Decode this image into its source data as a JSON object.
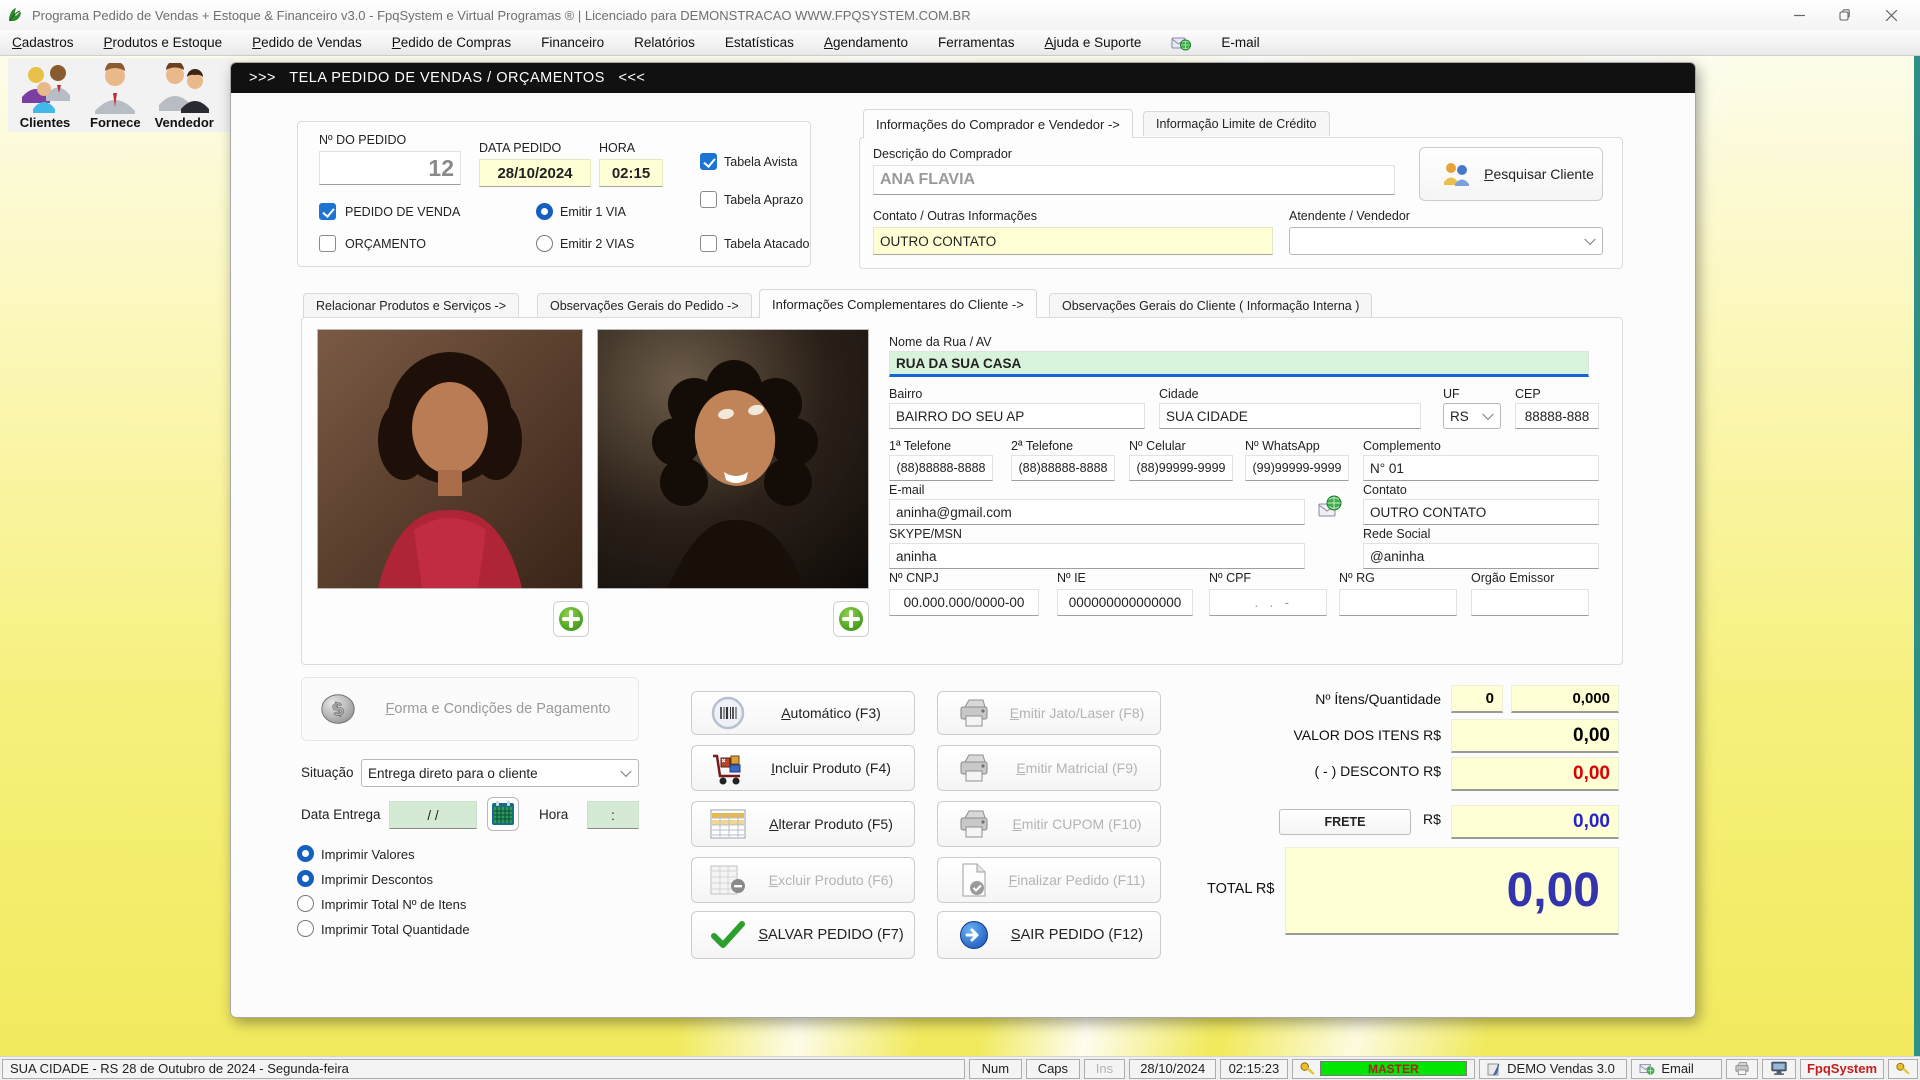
{
  "window": {
    "title": "Programa Pedido de Vendas + Estoque & Financeiro v3.0 - FpqSystem e Virtual Programas ® | Licenciado para  DEMONSTRACAO WWW.FPQSYSTEM.COM.BR"
  },
  "menu": {
    "cadastros": "Cadastros",
    "produtos": "Produtos e Estoque",
    "pedido_vendas": "Pedido de Vendas",
    "pedido_compras": "Pedido de Compras",
    "financeiro": "Financeiro",
    "relatorios": "Relatórios",
    "estatisticas": "Estatísticas",
    "agendamento": "Agendamento",
    "ferramentas": "Ferramentas",
    "ajuda": "Ajuda e Suporte",
    "email": "E-mail"
  },
  "toolbar": {
    "clientes": "Clientes",
    "fornece": "Fornece",
    "vendedor": "Vendedor"
  },
  "dialog": {
    "header": ">>>   TELA PEDIDO DE VENDAS / ORÇAMENTOS   <<<"
  },
  "order": {
    "numero_label": "Nº DO PEDIDO",
    "numero": "12",
    "data_label": "DATA PEDIDO",
    "data": "28/10/2024",
    "hora_label": "HORA",
    "hora": "02:15",
    "tabela_avista": "Tabela Avista",
    "pedido_venda": "PEDIDO DE VENDA",
    "orcamento": "ORÇAMENTO",
    "emitir1": "Emitir 1 VIA",
    "emitir2": "Emitir 2 VIAS",
    "tabela_aprazo": "Tabela Aprazo",
    "tabela_atacado": "Tabela Atacado"
  },
  "comprador": {
    "tab1": "Informações do Comprador e Vendedor  ->",
    "tab2": "Informação Limite de Crédito",
    "descricao_label": "Descrição do Comprador",
    "descricao": "ANA FLAVIA",
    "pesquisar": "Pesquisar Cliente",
    "contato_label": "Contato / Outras Informações",
    "contato": "OUTRO CONTATO",
    "atendente_label": "Atendente / Vendedor"
  },
  "tabs": {
    "t1": "Relacionar Produtos e Serviços  ->",
    "t2": "Observações Gerais do Pedido  ->",
    "t3": "Informações Complementares do Cliente  ->",
    "t4": "Observações Gerais do Cliente ( Informação Interna )"
  },
  "cliente": {
    "rua_label": "Nome da Rua / AV",
    "rua": "RUA DA SUA CASA",
    "bairro_label": "Bairro",
    "bairro": "BAIRRO DO SEU AP",
    "cidade_label": "Cidade",
    "cidade": "SUA CIDADE",
    "uf_label": "UF",
    "uf": "RS",
    "cep_label": "CEP",
    "cep": "88888-888",
    "tel1_label": "1ª Telefone",
    "tel1": "(88)88888-8888",
    "tel2_label": "2ª Telefone",
    "tel2": "(88)88888-8888",
    "celular_label": "Nº Celular",
    "celular": "(88)99999-9999",
    "whatsapp_label": "Nº WhatsApp",
    "whatsapp": "(99)99999-9999",
    "complemento_label": "Complemento",
    "complemento": "N° 01",
    "email_label": "E-mail",
    "email": "aninha@gmail.com",
    "contato_label": "Contato",
    "contato": "OUTRO CONTATO",
    "skype_label": "SKYPE/MSN",
    "skype": "aninha",
    "rede_label": "Rede Social",
    "rede": "@aninha",
    "cnpj_label": "Nº CNPJ",
    "cnpj": "00.000.000/0000-00",
    "ie_label": "Nº IE",
    "ie": "000000000000000",
    "cpf_label": "Nº CPF",
    "cpf": "  .   .   -",
    "rg_label": "Nº RG",
    "rg": "",
    "orgao_label": "Orgão Emissor",
    "orgao": ""
  },
  "pagamento": {
    "forma": "Forma e Condições de Pagamento",
    "situacao_label": "Situação",
    "situacao": "Entrega direto para o cliente",
    "data_entrega_label": "Data Entrega",
    "data_entrega": "/ /",
    "hora_label": "Hora",
    "hora": ":",
    "r1": "Imprimir Valores",
    "r2": "Imprimir Descontos",
    "r3": "Imprimir Total Nº de Itens",
    "r4": "Imprimir Total Quantidade"
  },
  "acoes": {
    "automatico": "Automático   (F3)",
    "incluir": "Incluir Produto  (F4)",
    "alterar": "Alterar Produto  (F5)",
    "excluir": "Excluir Produto  (F6)",
    "salvar": "SALVAR PEDIDO (F7)",
    "jato": "Emitir Jato/Laser (F8)",
    "matricial": "Emitir Matricial   (F9)",
    "cupom": "Emitir CUPOM   (F10)",
    "finalizar": "Finalizar Pedido  (F11)",
    "sair": "SAIR  PEDIDO  (F12)"
  },
  "totais": {
    "itens_label": "Nº Ítens/Quantidade",
    "itens": "0",
    "quantidade": "0,000",
    "valor_label": "VALOR DOS ITENS R$",
    "valor": "0,00",
    "desconto_label": "( - ) DESCONTO R$",
    "desconto": "0,00",
    "frete_label": "FRETE",
    "frete_rs": "R$",
    "frete": "0,00",
    "total_label": "TOTAL R$",
    "total": "0,00"
  },
  "statusbar": {
    "local": "SUA CIDADE - RS 28 de Outubro de 2024 - Segunda-feira",
    "num": "Num",
    "caps": "Caps",
    "ins": "Ins",
    "data": "28/10/2024",
    "hora": "02:15:23",
    "master": "MASTER",
    "demo": "DEMO Vendas 3.0",
    "email": "Email",
    "brand": "FpqSystem"
  },
  "colors": {
    "accent_blue": "#1d74d2",
    "value_red": "#dd0000",
    "value_blue": "#2424c8",
    "total_blue": "#3434ae",
    "master_green": "#00e600",
    "brand_red": "#c41e1e",
    "field_yellow": "#ffffd6",
    "field_green": "#d5ead5"
  }
}
